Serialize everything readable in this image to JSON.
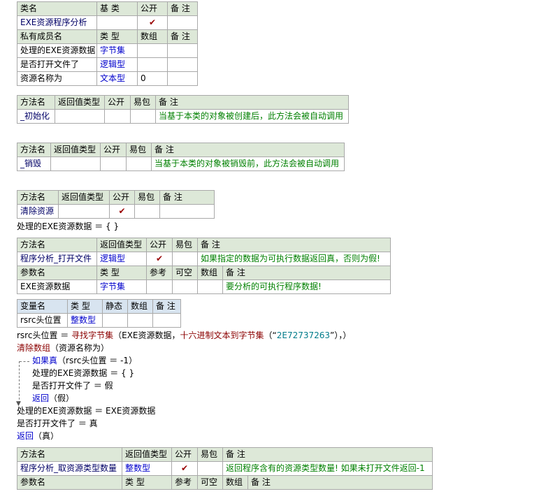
{
  "class_table": {
    "h_name": "类名",
    "h_base": "基 类",
    "h_public": "公开",
    "h_note": "备 注",
    "name": "EXE资源程序分析",
    "base": "",
    "public": "✔",
    "note": "",
    "m_h_name": "私有成员名",
    "m_h_type": "类 型",
    "m_h_array": "数组",
    "m_h_note": "备 注",
    "members": [
      {
        "name": "处理的EXE资源数据",
        "type": "字节集",
        "array": "",
        "note": ""
      },
      {
        "name": "是否打开文件了",
        "type": "逻辑型",
        "array": "",
        "note": ""
      },
      {
        "name": "资源名称为",
        "type": "文本型",
        "array": "0",
        "note": ""
      }
    ]
  },
  "hdr": {
    "method": "方法名",
    "ret": "返回值类型",
    "public": "公开",
    "easy": "易包",
    "note": "备 注",
    "param": "参数名",
    "type": "类 型",
    "ref": "参考",
    "optional": "可空",
    "array": "数组",
    "var": "变量名",
    "static": "静态"
  },
  "m_init": {
    "name": "_初始化",
    "ret": "",
    "public": "",
    "easy": "",
    "note": "当基于本类的对象被创建后，此方法会被自动调用"
  },
  "m_destroy": {
    "name": "_销毁",
    "ret": "",
    "public": "",
    "easy": "",
    "note": "当基于本类的对象被销毁前，此方法会被自动调用"
  },
  "m_clear": {
    "name": "清除资源",
    "ret": "",
    "public": "✔",
    "easy": "",
    "note": "",
    "code": "处理的EXE资源数据 ＝ {  }"
  },
  "m_open": {
    "name": "程序分析_打开文件",
    "ret": "逻辑型",
    "public": "✔",
    "easy": "",
    "note": "如果指定的数据为可执行数据返回真，否则为假!",
    "param": {
      "name": "EXE资源数据",
      "type": "字节集",
      "ref": "",
      "optional": "",
      "array": "",
      "note": "要分析的可执行程序数据!"
    },
    "var": {
      "name": "rsrc头位置",
      "type": "整数型",
      "static": "",
      "array": "",
      "note": ""
    }
  },
  "code": {
    "l1_var": "rsrc头位置",
    "l1_eq": " ＝ ",
    "l1_fn": "寻找字节集",
    "l1_a": "（EXE资源数据，",
    "l1_fn2": "十六进制文本到字节集",
    "l1_b": "（“",
    "l1_str": "2E72737263",
    "l1_c": "”），）",
    "l2_fn": "清除数组",
    "l2_a": "（资源名称为）",
    "l3_fn": "如果真",
    "l3_a": "（rsrc头位置 ＝ -1）",
    "l4": "处理的EXE资源数据 ＝ {  }",
    "l5": "是否打开文件了 ＝ 假",
    "l6_fn": "返回",
    "l6_a": "（假）",
    "l7": "处理的EXE资源数据 ＝ EXE资源数据",
    "l8": "是否打开文件了 ＝ 真",
    "l9_fn": "返回",
    "l9_a": "（真）"
  },
  "m_count": {
    "name": "程序分析_取资源类型数量",
    "ret": "整数型",
    "public": "✔",
    "easy": "",
    "note": "返回程序含有的资源类型数量! 如果未打开文件返回-1"
  }
}
